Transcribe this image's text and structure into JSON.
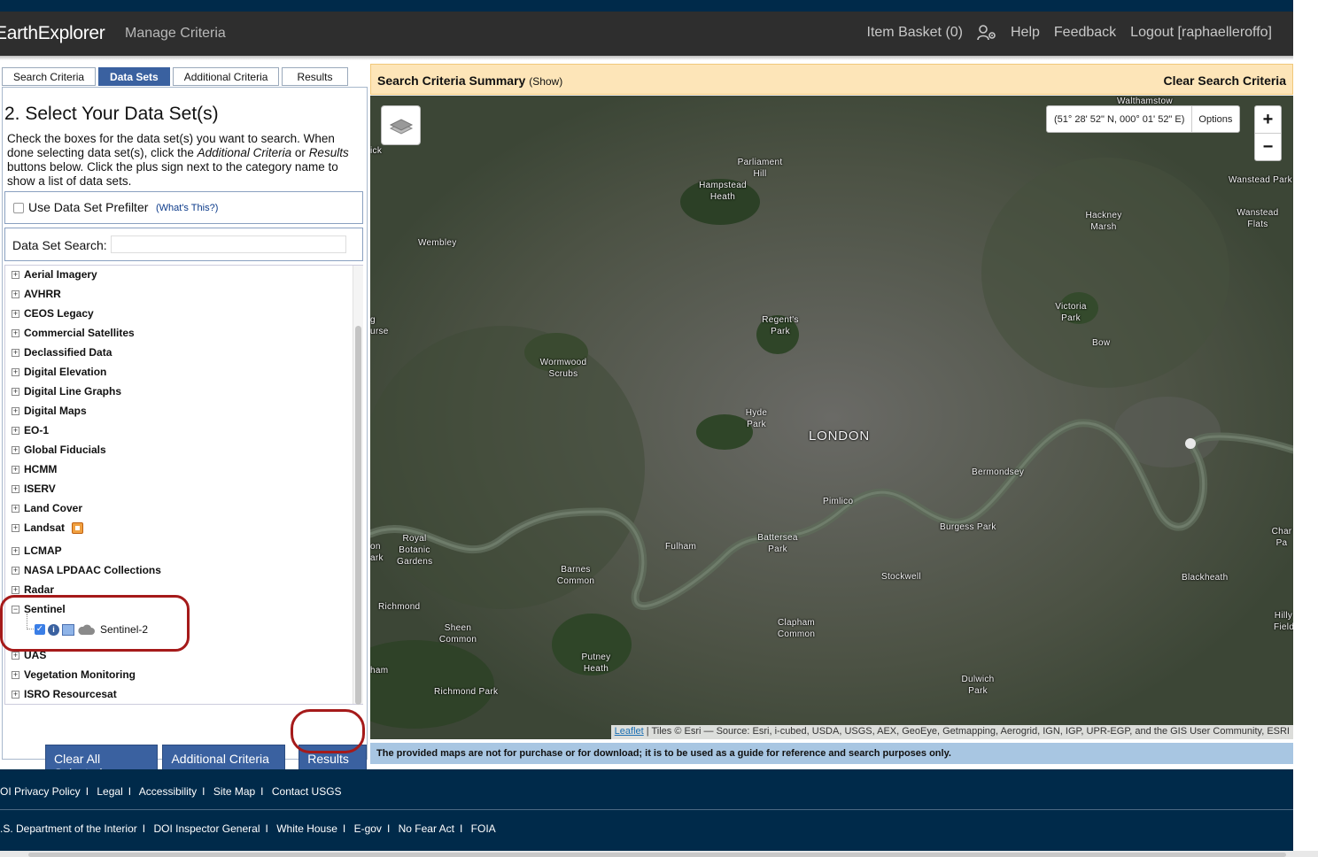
{
  "header": {
    "brand": "EarthExplorer",
    "manage": "Manage Criteria",
    "item_basket": "Item Basket (0)",
    "help": "Help",
    "feedback": "Feedback",
    "logout": "Logout [raphaelleroffo]"
  },
  "tabs": [
    "Search Criteria",
    "Data Sets",
    "Additional Criteria",
    "Results"
  ],
  "datasets": {
    "heading": "2. Select Your Data Set(s)",
    "instr_1": "Check the boxes for the data set(s) you want to search. When done selecting data set(s), click the ",
    "instr_em1": "Additional Criteria",
    "instr_2": " or ",
    "instr_em2": "Results",
    "instr_3": " buttons below. Click the plus sign next to the category name to show a list of data sets.",
    "prefilter_label": "Use Data Set Prefilter",
    "prefilter_help": "(What's This?)",
    "search_label": "Data Set Search:",
    "search_value": "",
    "categories": [
      "Aerial Imagery",
      "AVHRR",
      "CEOS Legacy",
      "Commercial Satellites",
      "Declassified Data",
      "Digital Elevation",
      "Digital Line Graphs",
      "Digital Maps",
      "EO-1",
      "Global Fiducials",
      "HCMM",
      "ISERV",
      "Land Cover",
      "Landsat",
      "LCMAP",
      "NASA LPDAAC Collections",
      "Radar",
      "Sentinel",
      "UAS",
      "Vegetation Monitoring",
      "ISRO Resourcesat"
    ],
    "sentinel_child": "Sentinel-2"
  },
  "buttons": {
    "clear": "Clear All Selected",
    "additional": "Additional Criteria »",
    "results": "Results »"
  },
  "summary": {
    "title": "Search Criteria Summary",
    "show": "(Show)",
    "clear": "Clear Search Criteria"
  },
  "map": {
    "coords": "(51° 28' 52\" N, 000° 01' 52\" E)",
    "options": "Options",
    "zoom_in": "+",
    "zoom_out": "−",
    "labels": [
      "Walthamstow",
      "Wanstead Park",
      "Wanstead Flats",
      "Parliament Hill",
      "Hampstead Heath",
      "Hackney Marsh",
      "Wembley",
      "Regent's Park",
      "Victoria Park",
      "Bow",
      "Wormwood Scrubs",
      "Hyde Park",
      "LONDON",
      "Bermondsey",
      "Pimlico",
      "Burgess Park",
      "Royal Botanic Gardens",
      "Battersea Park",
      "Fulham",
      "Barnes Common",
      "Stockwell",
      "Blackheath",
      "Richmond",
      "Sheen Common",
      "Clapham Common",
      "Hilly Fields",
      "Putney Heath",
      "Dulwich Park",
      "Richmond Park",
      "Char Pa",
      "ick",
      "g urse",
      "on ark",
      "ham"
    ],
    "attrib_link": "Leaflet",
    "attrib_text": " | Tiles © Esri — Source: Esri, i-cubed, USDA, USGS, AEX, GeoEye, Getmapping, Aerogrid, IGN, IGP, UPR-EGP, and the GIS User Community, ESRI"
  },
  "disclaimer": "The provided maps are not for purchase or for download; it is to be used as a guide for reference and search purposes only.",
  "footer": {
    "row1": [
      "OI Privacy Policy",
      "Legal",
      "Accessibility",
      "Site Map",
      "Contact USGS"
    ],
    "row2": [
      ".S. Department of the Interior",
      "DOI Inspector General",
      "White House",
      "E-gov",
      "No Fear Act",
      "FOIA"
    ]
  }
}
